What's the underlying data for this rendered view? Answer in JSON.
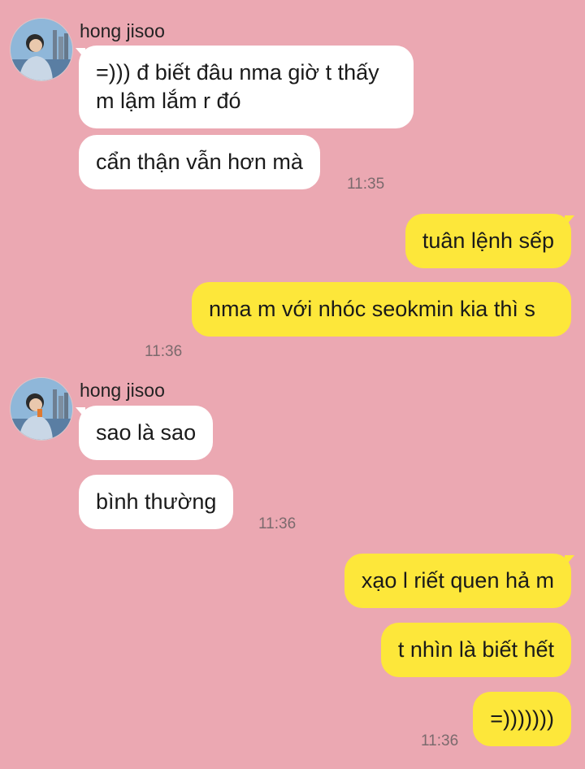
{
  "colors": {
    "background": "#eba8b2",
    "incoming_bubble": "#ffffff",
    "outgoing_bubble": "#fde73a",
    "timestamp": "#7b6a6d"
  },
  "groups": [
    {
      "sender": "hong jisoo",
      "avatar_icon": "profile-photo-avatar",
      "messages": [
        "=))) đ biết đâu nma giờ t thấy m lậm lắm r đó",
        "cẩn thận vẫn hơn mà"
      ],
      "time": "11:35"
    },
    {
      "sender": "me",
      "messages": [
        "tuân lệnh sếp",
        "nma m với nhóc seokmin kia thì s"
      ],
      "time": "11:36"
    },
    {
      "sender": "hong jisoo",
      "avatar_icon": "profile-photo-avatar",
      "messages": [
        "sao là sao",
        "bình thường"
      ],
      "time": "11:36"
    },
    {
      "sender": "me",
      "messages": [
        "xạo l riết quen hả m",
        "t nhìn là biết hết",
        "=)))))))"
      ],
      "time": "11:36"
    }
  ]
}
